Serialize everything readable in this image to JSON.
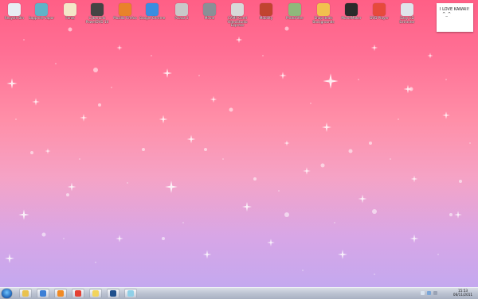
{
  "desktop": {
    "icons": [
      {
        "label": "Recycle Bin",
        "icon": "recycle-bin-icon",
        "color": "#e8edf3"
      },
      {
        "label": "Sapphire Vapor",
        "icon": "sapphire-vapor-icon",
        "color": "#5fb3c7"
      },
      {
        "label": "Fonts",
        "icon": "fonts-icon",
        "color": "#f4e7c8"
      },
      {
        "label": "CyberLink PowerDVD 10",
        "icon": "powerdvd-icon",
        "color": "#444444"
      },
      {
        "label": "Mozilla Firefox",
        "icon": "firefox-icon",
        "color": "#e9822a"
      },
      {
        "label": "Google Chrome",
        "icon": "chrome-icon",
        "color": "#3b8de0"
      },
      {
        "label": "Picasa 3",
        "icon": "picasa-icon",
        "color": "#c8c8c8"
      },
      {
        "label": "Movie",
        "icon": "movie-icon",
        "color": "#8a8f96"
      },
      {
        "label": "CAMP Corel VideoStudio Express",
        "icon": "corel-videostudio-icon",
        "color": "#d8d8d8"
      },
      {
        "label": "Mobility",
        "icon": "mobility-icon",
        "color": "#c1442f"
      },
      {
        "label": "PhotoFilter",
        "icon": "photofilter-icon",
        "color": "#8fb87b"
      },
      {
        "label": "Shop deals Backgrounds",
        "icon": "shop-deals-icon",
        "color": "#f2c14e"
      },
      {
        "label": "MovieMaker",
        "icon": "moviemaker-icon",
        "color": "#2b2b2b"
      },
      {
        "label": "DVD Player",
        "icon": "dvd-player-icon",
        "color": "#e64a3c"
      },
      {
        "label": "Easy CD Extractor",
        "icon": "cd-extractor-icon",
        "color": "#e0e4ea"
      }
    ],
    "sticky_note": {
      "text": "I LOVE KAWAII!\n  ^_^"
    }
  },
  "taskbar": {
    "start_icon": "windows-start-icon",
    "pinned": [
      {
        "name": "explorer-icon",
        "color": "#e9c24f"
      },
      {
        "name": "internet-explorer-icon",
        "color": "#3b7fd6"
      },
      {
        "name": "media-player-icon",
        "color": "#f08a24"
      },
      {
        "name": "chrome-icon",
        "color": "#e44134"
      },
      {
        "name": "film-strip-icon",
        "color": "#f2d45c"
      },
      {
        "name": "photoshop-icon",
        "color": "#1f4f8c"
      },
      {
        "name": "windows-live-icon",
        "color": "#8fd0e8"
      }
    ],
    "tray_icons": [
      {
        "name": "flag-icon",
        "color": "#d9e3f0"
      },
      {
        "name": "network-icon",
        "color": "#7aa6d8"
      },
      {
        "name": "volume-icon",
        "color": "#9aa3b5"
      }
    ],
    "clock": {
      "time": "15:53",
      "date": "06/11/2011"
    }
  },
  "colors": {
    "top": "#ff5f86",
    "bottom": "#c4a8ef"
  }
}
